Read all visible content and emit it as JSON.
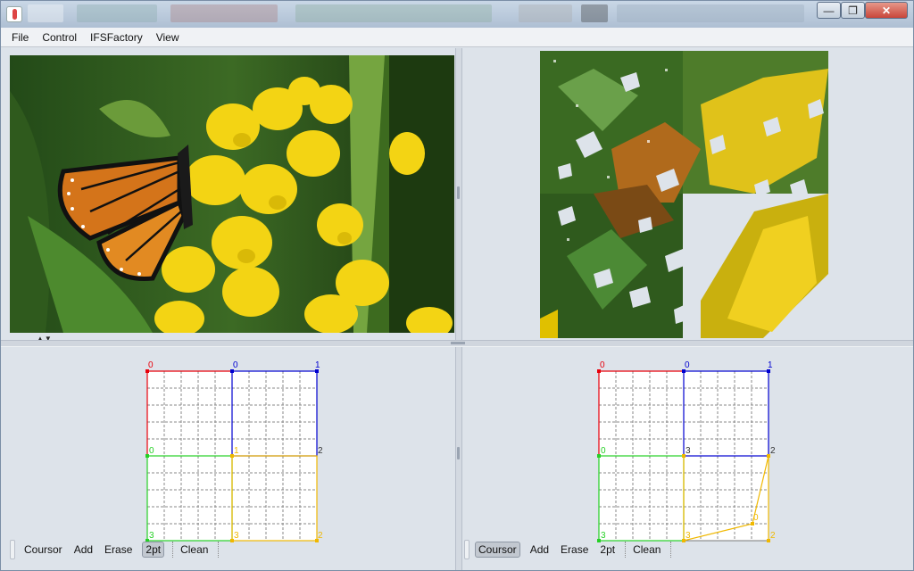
{
  "menu": {
    "items": [
      "File",
      "Control",
      "IFSFactory",
      "View"
    ]
  },
  "window_controls": {
    "minimize": "—",
    "maximize": "❐",
    "close": "✕"
  },
  "split_arrows": "▲▼",
  "editors": [
    {
      "toolbar": {
        "tools": [
          "Coursor",
          "Add",
          "Erase",
          "2pt"
        ],
        "active": "2pt",
        "clean": "Clean"
      },
      "labels": {
        "red_tl": "0",
        "blue_tl": "0",
        "blue_tr": "1",
        "green_tl": "0",
        "yellow_tl": "1",
        "blue_br": "2",
        "green_bl": "3",
        "yellow_bl": "3",
        "yellow_br": "2"
      }
    },
    {
      "toolbar": {
        "tools": [
          "Coursor",
          "Add",
          "Erase",
          "2pt"
        ],
        "active": "Coursor",
        "clean": "Clean"
      },
      "labels": {
        "red_tl": "0",
        "blue_tl": "0",
        "blue_tr": "1",
        "green_tl": "0",
        "yellow_tl": "3",
        "blue_br": "2",
        "green_bl": "3",
        "yellow_bl": "3",
        "yellow_br": "2",
        "yellow_mid": "0"
      }
    }
  ],
  "colors": {
    "red": "#e8000b",
    "blue": "#0000d0",
    "green": "#25d025",
    "yellow": "#f0b800"
  }
}
